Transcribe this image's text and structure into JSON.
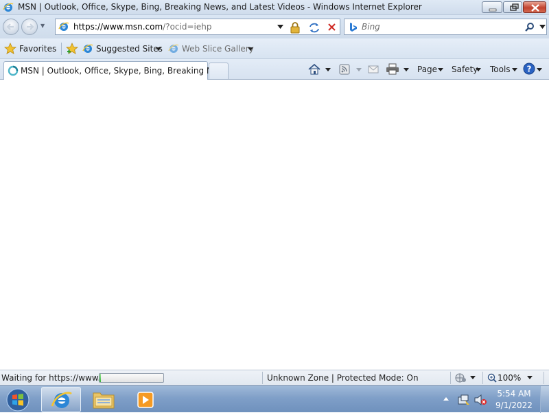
{
  "window": {
    "title": "MSN | Outlook, Office, Skype, Bing, Breaking News, and Latest Videos - Windows Internet Explorer"
  },
  "address": {
    "url_host": "https://www.msn.com",
    "url_rest": "/?ocid=iehp"
  },
  "search": {
    "placeholder": "Bing"
  },
  "favorites_bar": {
    "favorites_label": "Favorites",
    "suggested_sites_label": "Suggested Sites",
    "web_slice_gallery_label": "Web Slice Gallery"
  },
  "tab": {
    "label": "MSN | Outlook, Office, Skype, Bing, Breaking Ne..."
  },
  "command_bar": {
    "page_label": "Page",
    "safety_label": "Safety",
    "tools_label": "Tools"
  },
  "status_bar": {
    "status_text": "Waiting for https://www.n",
    "progress_fraction": 0.02,
    "zone_text": "Unknown Zone | Protected Mode: On",
    "zoom_text": "100%"
  },
  "taskbar": {
    "clock_time": "5:54 AM",
    "clock_date": "9/1/2022"
  },
  "colors": {
    "progress_green": "#37b43a",
    "close_button_red": "#c2432f",
    "taskbar_blue": "#7f9fc8"
  },
  "icons": [
    "ie-icon",
    "minimize-icon",
    "maximize-icon",
    "close-icon",
    "back-arrow-icon",
    "forward-arrow-icon",
    "lock-icon",
    "refresh-icon",
    "stop-icon",
    "bing-icon",
    "search-icon",
    "favorites-star-icon",
    "add-favorite-icon",
    "home-icon",
    "feeds-icon",
    "mail-icon",
    "print-icon",
    "help-icon",
    "windows-logo-icon",
    "folder-icon",
    "media-player-icon",
    "network-icon",
    "volume-muted-icon"
  ]
}
